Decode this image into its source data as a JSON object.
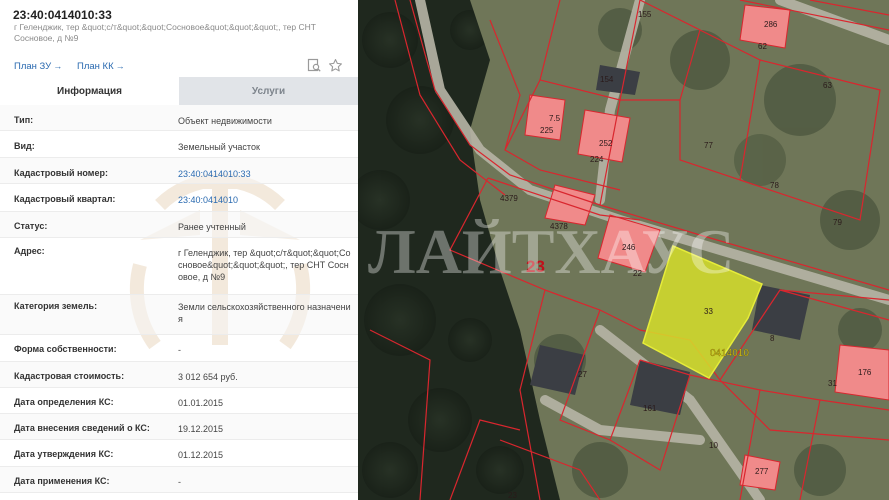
{
  "header": {
    "title": "23:40:0414010:33",
    "subtitle": "г Геленджик, тер &quot;с/т&quot;&quot;Сосновое&quot;&quot;&quot;, тер СНТ Сосновое, д №9"
  },
  "links": {
    "plan_zu": "План ЗУ",
    "plan_kk": "План КК",
    "arrow": "→"
  },
  "icons": {
    "search": "search-doc-icon",
    "favorite": "star-icon"
  },
  "tabs": {
    "info": "Информация",
    "services": "Услуги"
  },
  "rows": [
    {
      "label": "Тип:",
      "value": "Объект недвижимости"
    },
    {
      "label": "Вид:",
      "value": "Земельный участок"
    },
    {
      "label": "Кадастровый номер:",
      "value": "23:40:0414010:33"
    },
    {
      "label": "Кадастровый квартал:",
      "value": "23:40:0414010"
    },
    {
      "label": "Статус:",
      "value": "Ранее учтенный"
    },
    {
      "label": "Адрес:",
      "value": "г Геленджик, тер &quot;с/т&quot;&quot;Сосновое&quot;&quot;&quot;, тер СНТ Сосновое, д №9"
    },
    {
      "label": "Категория земель:",
      "value": "Земли сельскохозяйственного назначения"
    },
    {
      "label": "Форма собственности:",
      "value": "-"
    },
    {
      "label": "Кадастровая стоимость:",
      "value": "3 012 654 руб."
    },
    {
      "label": "Дата определения КС:",
      "value": "01.01.2015"
    },
    {
      "label": "Дата внесения сведений о КС:",
      "value": "19.12.2015"
    },
    {
      "label": "Дата утверждения КС:",
      "value": "01.12.2015"
    },
    {
      "label": "Дата применения КС:",
      "value": "-"
    }
  ],
  "map": {
    "watermark": "ЛАЙТХАУС",
    "block_number": "23",
    "selected_plot": "33",
    "quarter_label": "0414010",
    "plot_labels": [
      "155",
      "286",
      "62",
      "154",
      "63",
      "7.5",
      "225",
      "252",
      "224",
      "77",
      "78",
      "4379",
      "4378",
      "79",
      "246",
      "22",
      "8",
      "27",
      "161",
      "10",
      "31",
      "176",
      "23",
      "277"
    ],
    "colors": {
      "boundary": "#d9262e",
      "selected_fill": "#d6df2a",
      "building": "#f08a8a",
      "link": "#2a6ab0"
    }
  }
}
